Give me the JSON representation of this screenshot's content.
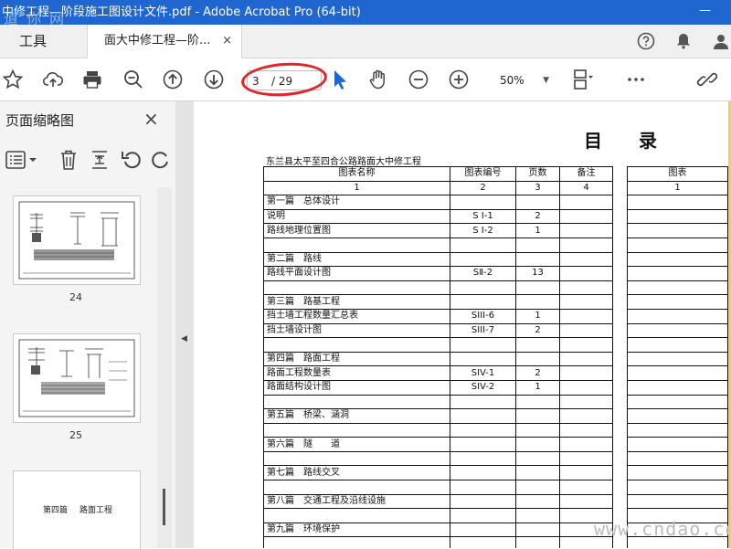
{
  "window": {
    "title": "中修工程—阶段施工图设计文件.pdf - Adobe Acrobat Pro (64-bit)",
    "minimize": "—",
    "watermark": "道 你 网"
  },
  "tabs": {
    "tools": "工具",
    "document": "面大中修工程—阶...",
    "close": "×"
  },
  "toolbar": {
    "current_page": "3",
    "total_pages": "/ 29",
    "zoom": "50%",
    "zoom_caret": "▼",
    "icons": [
      "star-icon",
      "cloud-upload-icon",
      "print-icon",
      "zoom-out-search-icon",
      "page-up-icon",
      "page-down-icon",
      "select-cursor-icon",
      "hand-tool-icon",
      "zoom-out-icon",
      "zoom-in-icon",
      "page-layout-icon",
      "more-icon",
      "sign-icon"
    ]
  },
  "sidebar": {
    "title": "页面缩略图",
    "close": "×",
    "thumbnails": [
      {
        "label": "24"
      },
      {
        "label": "25"
      },
      {
        "label": "",
        "text_a": "第四篇",
        "text_b": "路面工程"
      }
    ]
  },
  "document": {
    "heading": "目录",
    "project": "东兰县太平至四合公路路面大中修工程",
    "headers": [
      "图表名称",
      "图表编号",
      "页数",
      "备注"
    ],
    "header_numbers": [
      "1",
      "2",
      "3",
      "4"
    ],
    "rows": [
      [
        "第一篇　总体设计",
        "",
        "",
        ""
      ],
      [
        "说明",
        "S Ⅰ-1",
        "2",
        ""
      ],
      [
        "路线地理位置图",
        "S Ⅰ-2",
        "1",
        ""
      ],
      [
        "",
        "",
        "",
        ""
      ],
      [
        "第二篇　路线",
        "",
        "",
        ""
      ],
      [
        "路线平面设计图",
        "SⅡ-2",
        "13",
        ""
      ],
      [
        "",
        "",
        "",
        ""
      ],
      [
        "第三篇　路基工程",
        "",
        "",
        ""
      ],
      [
        "挡土墙工程数量汇总表",
        "SIII-6",
        "1",
        ""
      ],
      [
        "挡土墙设计图",
        "SIII-7",
        "2",
        ""
      ],
      [
        "",
        "",
        "",
        ""
      ],
      [
        "第四篇　路面工程",
        "",
        "",
        ""
      ],
      [
        "路面工程数量表",
        "SIV-1",
        "2",
        ""
      ],
      [
        "路面结构设计图",
        "SIV-2",
        "1",
        ""
      ],
      [
        "",
        "",
        "",
        ""
      ],
      [
        "第五篇　桥梁、涵洞",
        "",
        "",
        ""
      ],
      [
        "",
        "",
        "",
        ""
      ],
      [
        "第六篇　隧　　道",
        "",
        "",
        ""
      ],
      [
        "",
        "",
        "",
        ""
      ],
      [
        "第七篇　路线交叉",
        "",
        "",
        ""
      ],
      [
        "",
        "",
        "",
        ""
      ],
      [
        "第八篇　交通工程及沿线设施",
        "",
        "",
        ""
      ],
      [
        "",
        "",
        "",
        ""
      ],
      [
        "第九篇　环境保护",
        "",
        "",
        ""
      ],
      [
        "",
        "",
        "",
        ""
      ]
    ],
    "second_col_header": "图表",
    "second_col_number": "1",
    "watermark": "www.cndao.com"
  }
}
